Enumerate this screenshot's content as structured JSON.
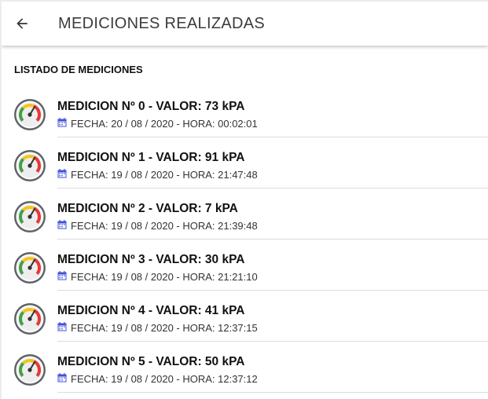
{
  "toolbar": {
    "title": "MEDICIONES REALIZADAS",
    "back_icon": "arrow-back-icon"
  },
  "section": {
    "header": "LISTADO DE MEDICIONES"
  },
  "colors": {
    "gauge_green": "#43a047",
    "gauge_yellow": "#f5c518",
    "gauge_red": "#e53935",
    "calendar": "#3f51d8"
  },
  "measurements": [
    {
      "title": "MEDICION Nº 0 - VALOR: 73 kPA",
      "subtitle": "FECHA: 20 / 08 / 2020 - HORA: 00:02:01"
    },
    {
      "title": "MEDICION Nº 1 - VALOR: 91 kPA",
      "subtitle": "FECHA: 19 / 08 / 2020 - HORA: 21:47:48"
    },
    {
      "title": "MEDICION Nº 2 - VALOR: 7 kPA",
      "subtitle": "FECHA: 19 / 08 / 2020 - HORA: 21:39:48"
    },
    {
      "title": "MEDICION Nº 3 - VALOR: 30 kPA",
      "subtitle": "FECHA: 19 / 08 / 2020 - HORA: 21:21:10"
    },
    {
      "title": "MEDICION Nº 4 - VALOR: 41 kPA",
      "subtitle": "FECHA: 19 / 08 / 2020 - HORA: 12:37:15"
    },
    {
      "title": "MEDICION Nº 5 - VALOR: 50 kPA",
      "subtitle": "FECHA: 19 / 08 / 2020 - HORA: 12:37:12"
    }
  ]
}
